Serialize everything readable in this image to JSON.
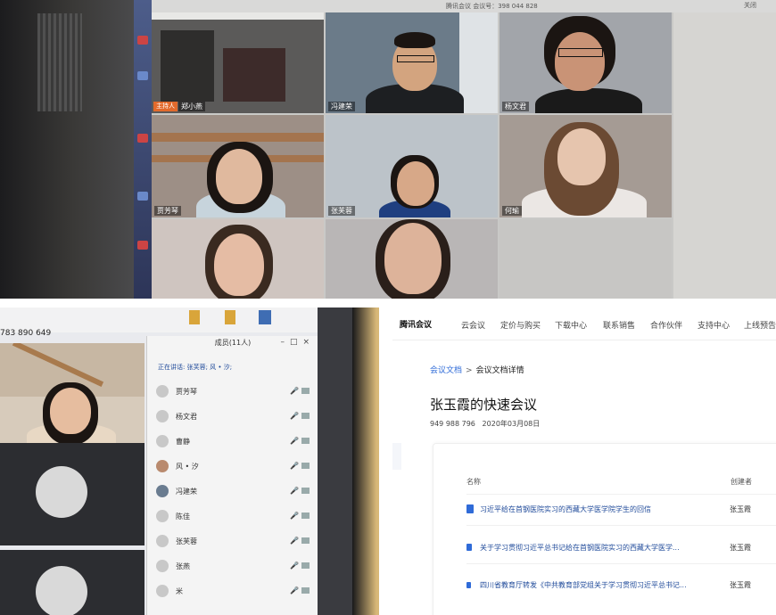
{
  "top_screenshot": {
    "titlebar_text": "腾讯会议 会议号：398 044 828",
    "window_control": "关闭",
    "tiles": [
      {
        "name": "郑小燕",
        "host_badge": "主持人"
      },
      {
        "name": "冯建荣"
      },
      {
        "name": "杨文君"
      },
      {
        "name": "贾芳琴"
      },
      {
        "name": "张芙蓉"
      },
      {
        "name": "何瑜"
      },
      {
        "name": ""
      },
      {
        "name": ""
      },
      {
        "name": ""
      }
    ]
  },
  "member_screenshot": {
    "meeting_id_fragment": "783 890 649",
    "panel_title": "成员(11人)",
    "speaking_text": "正在讲话: 张芙蓉; 风 • 汐;",
    "members": [
      "贾芳琴",
      "杨文君",
      "曹静",
      "风 • 汐",
      "冯建荣",
      "陈佳",
      "张芙蓉",
      "张燕",
      "米"
    ],
    "mic_label": "🎤"
  },
  "doc_page": {
    "brand": "腾讯会议",
    "nav": [
      "云会议",
      "定价与购买",
      "下载中心",
      "联系销售",
      "合作伙伴",
      "支持中心",
      "上线预告"
    ],
    "breadcrumb": {
      "root": "会议文档",
      "current": "会议文档详情"
    },
    "title": "张玉霞的快速会议",
    "meeting_no": "949 988 796",
    "date": "2020年03月08日",
    "columns": {
      "name": "名称",
      "creator": "创建者"
    },
    "rows": [
      {
        "name": "习近平给在首钢医院实习的西藏大学医学院学生的回信",
        "creator": "张玉霞"
      },
      {
        "name": "关于学习贯彻习近平总书记给在首钢医院实习的西藏大学医学...",
        "creator": "张玉霞"
      },
      {
        "name": "四川省教育厅转发《中共教育部党组关于学习贯彻习近平总书记...",
        "creator": "张玉霞"
      }
    ]
  }
}
